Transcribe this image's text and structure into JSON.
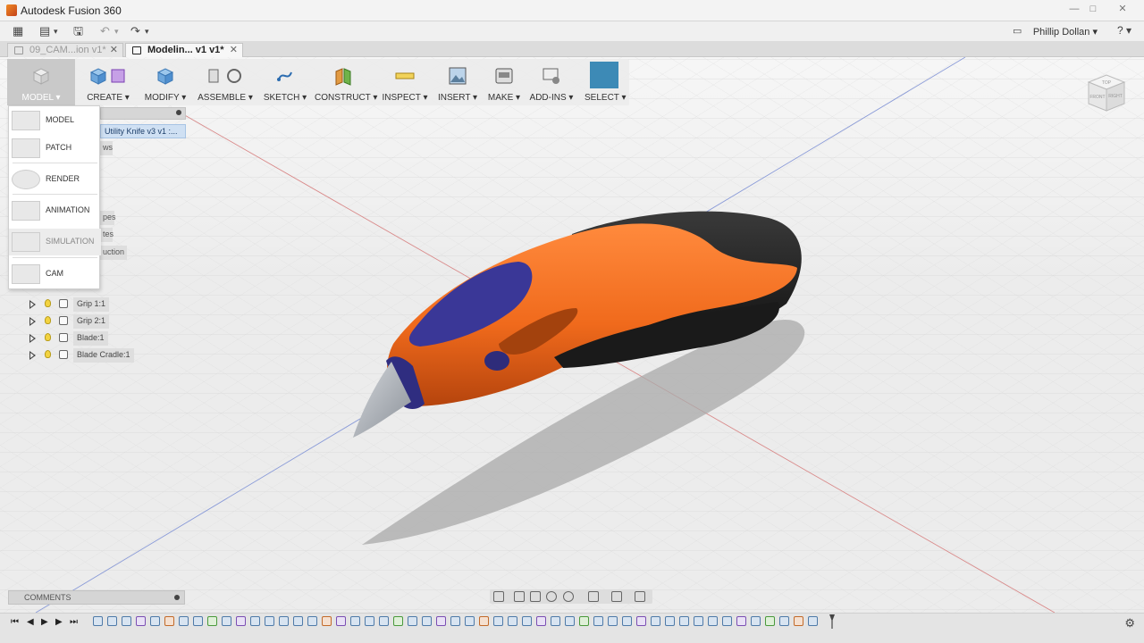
{
  "window": {
    "title": "Autodesk Fusion 360",
    "minimize": "—",
    "maximize": "□",
    "close": "✕"
  },
  "quick_access": {
    "grid": "▦",
    "file": "▤",
    "file_caret": "▾",
    "save": "🖫",
    "undo": "↶",
    "undo_caret": "▾",
    "redo": "↷",
    "redo_caret": "▾",
    "notifications": "▭",
    "user": "Phillip Dollan ▾",
    "help": "? ▾"
  },
  "tabs": [
    {
      "label": "09_CAM...ion v1*",
      "close": "✕"
    },
    {
      "label": "Modelin... v1 v1*",
      "close": "✕"
    }
  ],
  "toolbar": {
    "workspace": "MODEL ▾",
    "items": [
      {
        "label": "CREATE ▾",
        "icon": "box-icon"
      },
      {
        "label": "MODIFY ▾",
        "icon": "modify-icon"
      },
      {
        "label": "ASSEMBLE ▾",
        "icon": "assemble-icon"
      },
      {
        "label": "SKETCH ▾",
        "icon": "sketch-icon"
      },
      {
        "label": "CONSTRUCT ▾",
        "icon": "plane-icon"
      },
      {
        "label": "INSPECT ▾",
        "icon": "measure-icon"
      },
      {
        "label": "INSERT ▾",
        "icon": "image-icon"
      },
      {
        "label": "MAKE ▾",
        "icon": "printer-icon"
      },
      {
        "label": "ADD-INS ▾",
        "icon": "addins-icon"
      },
      {
        "label": "SELECT ▾",
        "icon": "select-icon"
      }
    ]
  },
  "workspace_menu": [
    "MODEL",
    "PATCH",
    "RENDER",
    "ANIMATION",
    "SIMULATION",
    "CAM"
  ],
  "browser": {
    "root": "Utility Knife v3 v1 :...",
    "fragments": [
      "ws",
      "pes",
      "tes",
      "uction"
    ],
    "components": [
      "Grip 1:1",
      "Grip 2:1",
      "Blade:1",
      "Blade Cradle:1"
    ]
  },
  "viewcube": {
    "front": "FRONT",
    "right": "RIGHT",
    "top": "TOP"
  },
  "comments": {
    "label": "COMMENTS"
  },
  "timeline": {
    "controls": [
      "⏮",
      "◀",
      "▶",
      "▶",
      "⏭"
    ],
    "settings": "⚙"
  }
}
